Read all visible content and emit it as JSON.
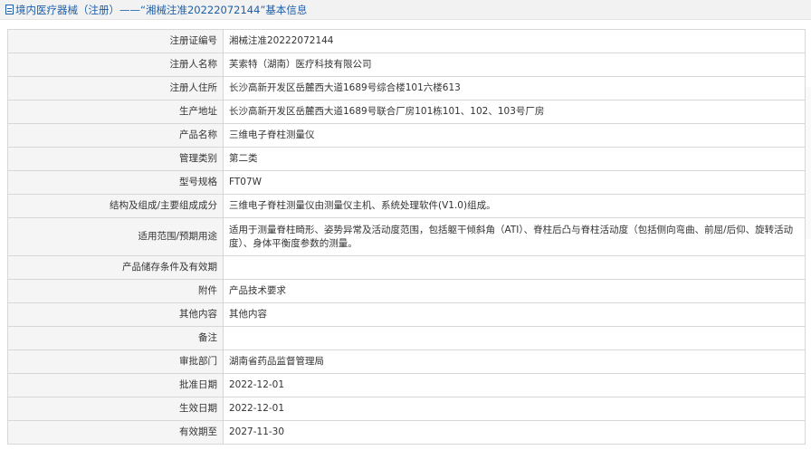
{
  "header": {
    "title": "境内医疗器械（注册）——“湘械注准20222072144”基本信息"
  },
  "rows": [
    {
      "label": "注册证编号",
      "value": "湘械注准20222072144"
    },
    {
      "label": "注册人名称",
      "value": "芙索特（湖南）医疗科技有限公司"
    },
    {
      "label": "注册人住所",
      "value": "长沙高新开发区岳麓西大道1689号综合楼101六楼613"
    },
    {
      "label": "生产地址",
      "value": "长沙高新开发区岳麓西大道1689号联合厂房101栋101、102、103号厂房"
    },
    {
      "label": "产品名称",
      "value": "三维电子脊柱测量仪"
    },
    {
      "label": "管理类别",
      "value": "第二类"
    },
    {
      "label": "型号规格",
      "value": "FT07W"
    },
    {
      "label": "结构及组成/主要组成成分",
      "value": "三维电子脊柱测量仪由测量仪主机、系统处理软件(V1.0)组成。"
    },
    {
      "label": "适用范围/预期用途",
      "value": "适用于测量脊柱畸形、姿势异常及活动度范围，包括躯干倾斜角（ATI）、脊柱后凸与脊柱活动度（包括侧向弯曲、前屈/后仰、旋转活动度）、身体平衡度参数的测量。"
    },
    {
      "label": "产品储存条件及有效期",
      "value": ""
    },
    {
      "label": "附件",
      "value": "产品技术要求"
    },
    {
      "label": "其他内容",
      "value": "其他内容"
    },
    {
      "label": "备注",
      "value": ""
    },
    {
      "label": "审批部门",
      "value": "湖南省药品监督管理局"
    },
    {
      "label": "批准日期",
      "value": "2022-12-01"
    },
    {
      "label": "生效日期",
      "value": "2022-12-01"
    },
    {
      "label": "有效期至",
      "value": "2027-11-30"
    }
  ],
  "colors": {
    "link": "#1e5fa8",
    "label_bg": "#f5f5f5",
    "border": "#d7d7d7"
  }
}
